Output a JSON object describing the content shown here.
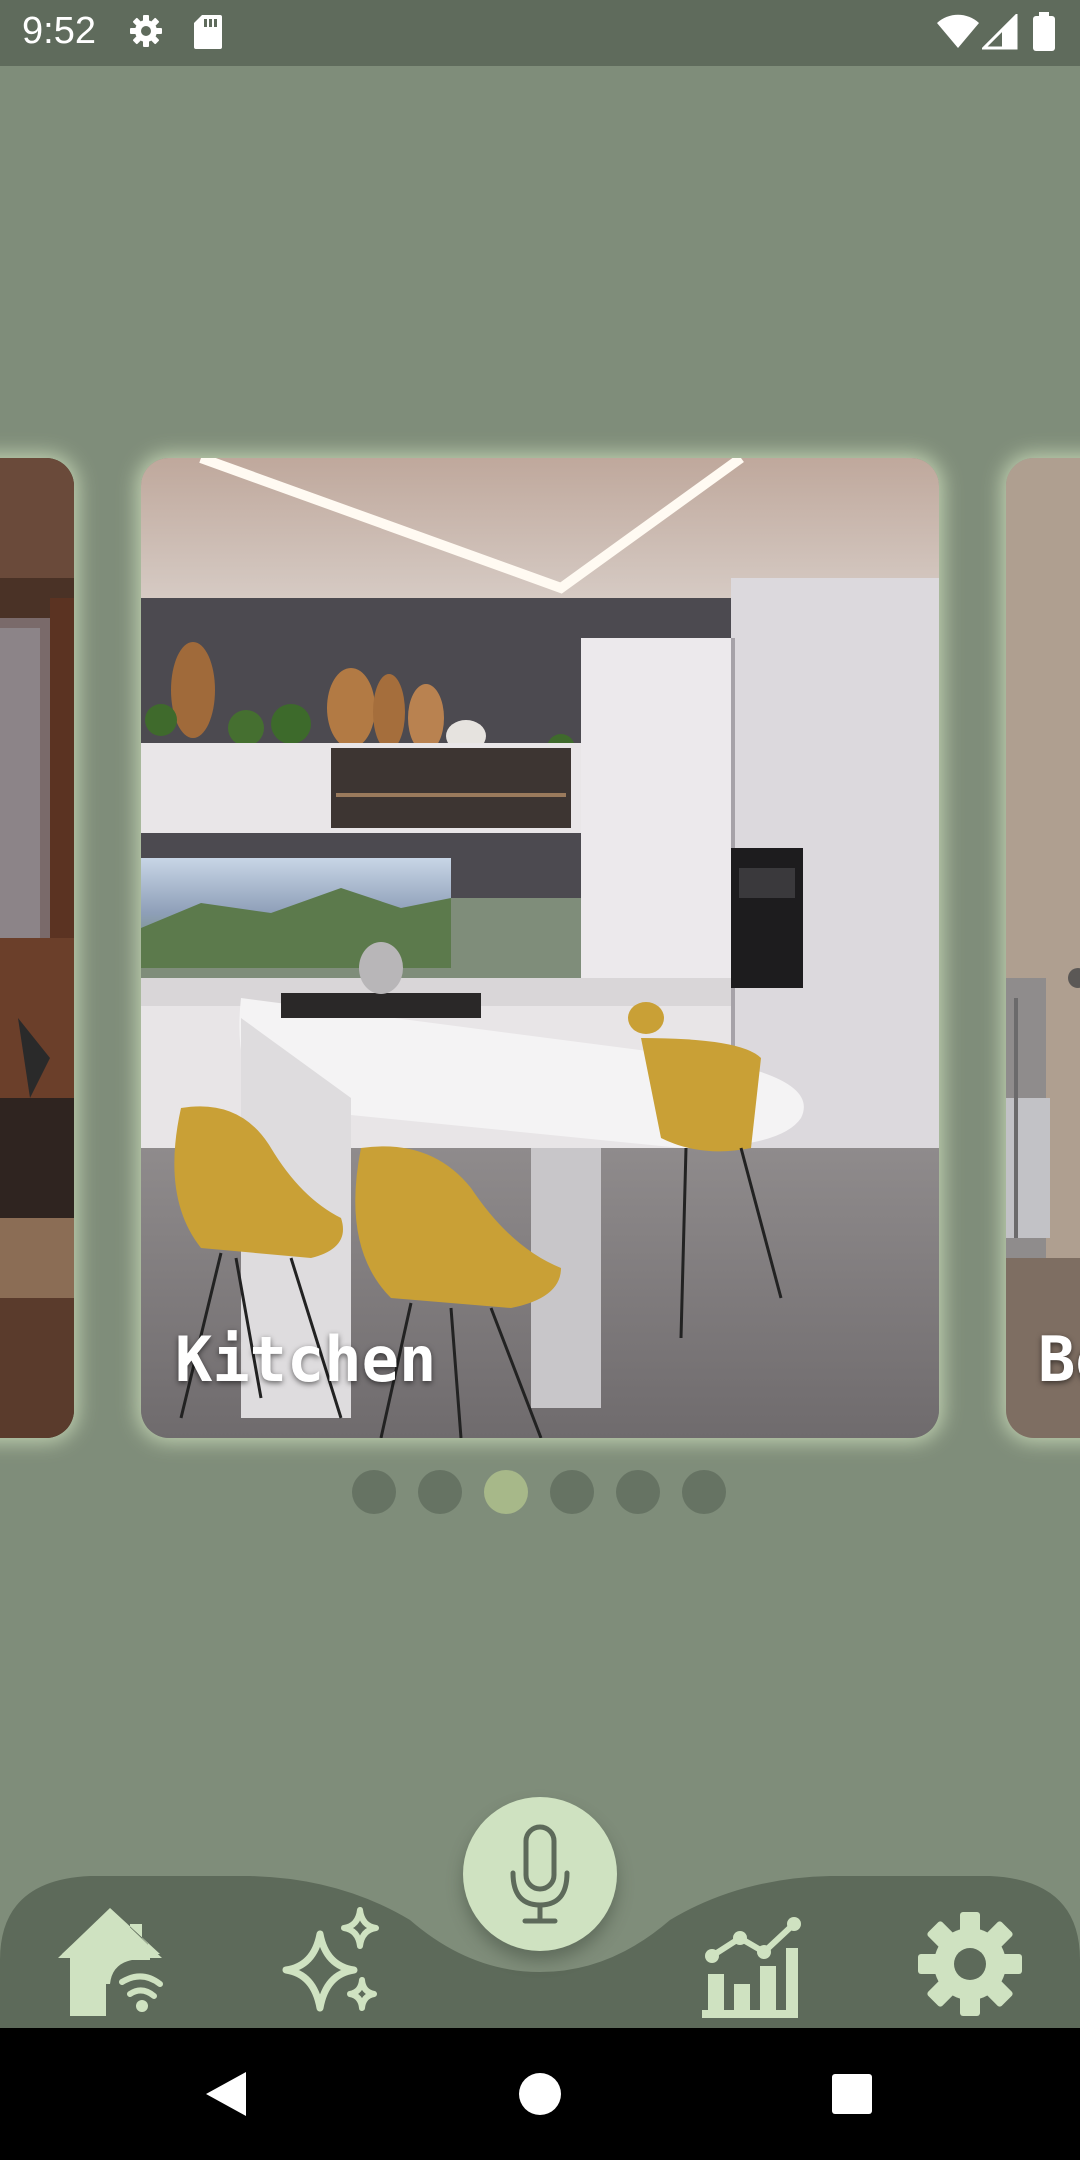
{
  "status_bar": {
    "time": "9:52",
    "left_icons": [
      "settings-gear-icon",
      "sd-card-icon"
    ],
    "right_icons": [
      "wifi-icon",
      "cell-signal-icon",
      "battery-icon"
    ]
  },
  "carousel": {
    "cards": [
      {
        "label": "",
        "visible": "partial-left"
      },
      {
        "label": "Kitchen",
        "visible": "full"
      },
      {
        "label": "Be",
        "visible": "partial-right"
      }
    ],
    "page_count": 6,
    "active_index": 2
  },
  "bottom_nav": {
    "items": [
      {
        "icon": "smart-home-icon"
      },
      {
        "icon": "sparkles-icon"
      },
      {
        "icon": "microphone-icon"
      },
      {
        "icon": "analytics-chart-icon"
      },
      {
        "icon": "settings-gear-icon"
      }
    ]
  },
  "colors": {
    "background": "#7f8d7a",
    "status_bar": "#5f6b5c",
    "nav_bar": "#5d6a5a",
    "accent": "#cfe2c1",
    "dot_active": "#a7b889",
    "dot_inactive": "#667363"
  },
  "system_nav": {
    "buttons": [
      "back-icon",
      "home-icon",
      "recents-icon"
    ]
  }
}
